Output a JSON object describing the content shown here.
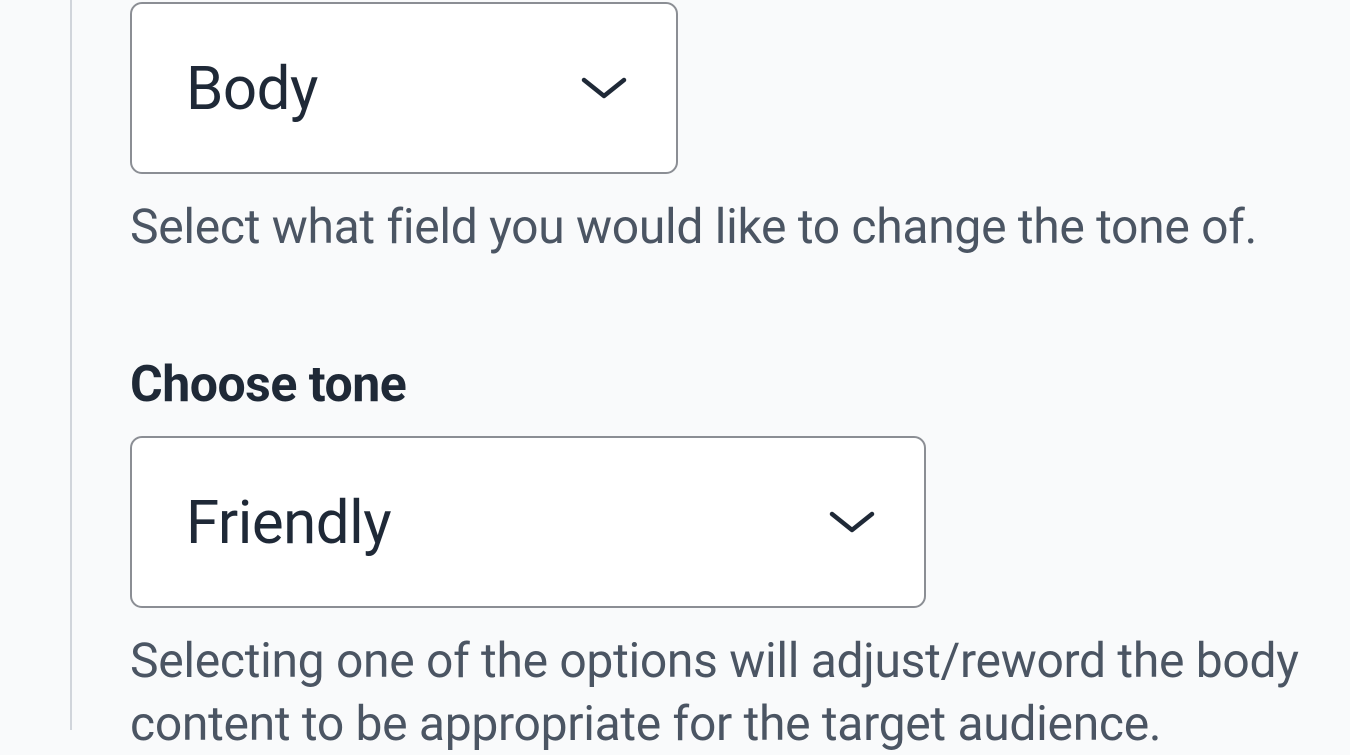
{
  "field_select": {
    "value": "Body",
    "helper": "Select what field you would like to change the tone of."
  },
  "tone_section": {
    "label": "Choose tone",
    "value": "Friendly",
    "helper": "Selecting one of the options will adjust/reword the body content to be appropriate for the target audience."
  }
}
